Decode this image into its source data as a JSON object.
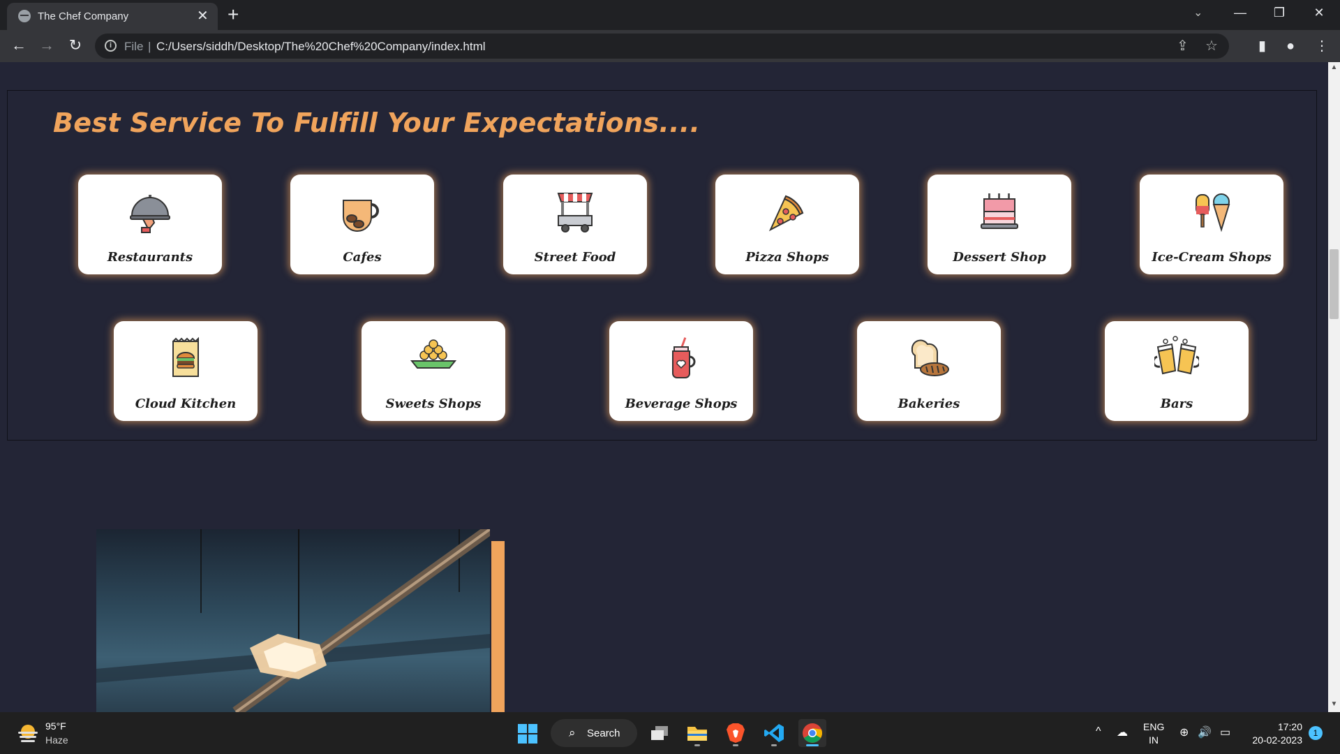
{
  "browser": {
    "tab_title": "The Chef Company",
    "tab_close": "✕",
    "new_tab": "+",
    "tab_search": "⌄",
    "window_minimize": "—",
    "window_restore": "❐",
    "window_close": "✕",
    "back": "←",
    "forward": "→",
    "reload": "↻",
    "omnibox_info": "i",
    "omnibox_scheme": "File",
    "omnibox_separator": "|",
    "url": "C:/Users/siddh/Desktop/The%20Chef%20Company/index.html",
    "share": "⇪",
    "bookmark": "☆",
    "side_panel": "▮",
    "profile": "●",
    "menu": "⋮"
  },
  "services": {
    "heading": "Best Service To Fulfill Your Expectations....",
    "row1": [
      {
        "label": "Restaurants",
        "icon": "cloche-icon"
      },
      {
        "label": "Cafes",
        "icon": "coffee-cup-icon"
      },
      {
        "label": "Street Food",
        "icon": "food-cart-icon"
      },
      {
        "label": "Pizza Shops",
        "icon": "pizza-slice-icon"
      },
      {
        "label": "Dessert Shop",
        "icon": "cake-icon"
      },
      {
        "label": "Ice-Cream Shops",
        "icon": "ice-cream-icon"
      }
    ],
    "row2": [
      {
        "label": "Cloud Kitchen",
        "icon": "burger-bag-icon"
      },
      {
        "label": "Sweets Shops",
        "icon": "sweets-plate-icon"
      },
      {
        "label": "Beverage Shops",
        "icon": "drink-jar-icon"
      },
      {
        "label": "Bakeries",
        "icon": "bread-icon"
      },
      {
        "label": "Bars",
        "icon": "beer-mugs-icon"
      }
    ]
  },
  "scrollbar": {
    "up": "▲",
    "down": "▼"
  },
  "taskbar": {
    "weather_temp": "95°F",
    "weather_desc": "Haze",
    "search_icon": "⌕",
    "search_label": "Search",
    "lang_line1": "ENG",
    "lang_line2": "IN",
    "time": "17:20",
    "date": "20-02-2023",
    "notification_count": "1",
    "tray_chevron": "^",
    "tray_cloud": "☁",
    "tray_globe": "⊕",
    "tray_volume": "🔊",
    "tray_battery": "▭"
  },
  "colors": {
    "page_bg": "#232536",
    "accent": "#f0a45c",
    "card_bg": "#ffffff",
    "taskbar_bg": "#202020",
    "windows_blue": "#4cc2ff"
  }
}
